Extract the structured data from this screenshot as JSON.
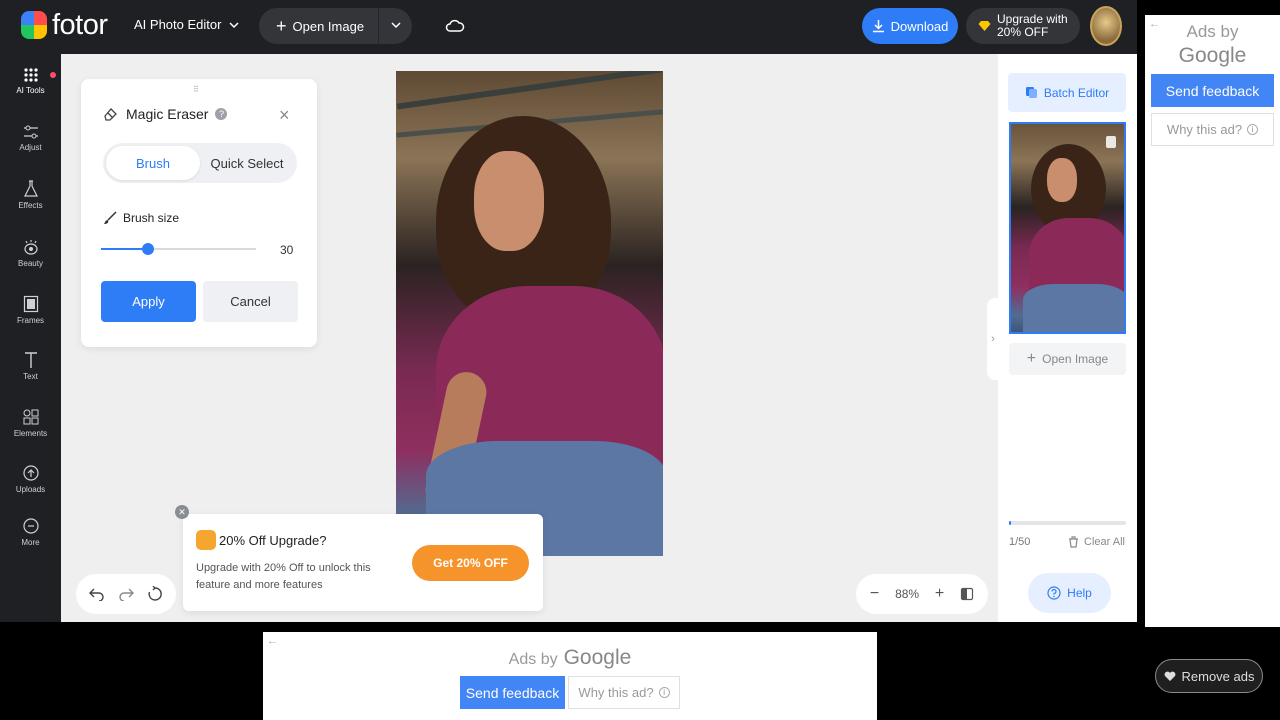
{
  "header": {
    "logo_text": "fotor",
    "app_menu": "AI Photo Editor",
    "open_image": "Open Image",
    "download": "Download",
    "upgrade_line1": "Upgrade with",
    "upgrade_line2": "20% OFF"
  },
  "sidebar": {
    "items": [
      {
        "label": "AI Tools",
        "icon": "grid-icon"
      },
      {
        "label": "Adjust",
        "icon": "sliders-icon"
      },
      {
        "label": "Effects",
        "icon": "flask-icon"
      },
      {
        "label": "Beauty",
        "icon": "eye-icon"
      },
      {
        "label": "Frames",
        "icon": "frame-icon"
      },
      {
        "label": "Text",
        "icon": "text-icon"
      },
      {
        "label": "Elements",
        "icon": "shapes-icon"
      },
      {
        "label": "Uploads",
        "icon": "upload-icon"
      },
      {
        "label": "More",
        "icon": "more-icon"
      }
    ]
  },
  "magic_eraser": {
    "title": "Magic Eraser",
    "tabs": [
      "Brush",
      "Quick Select"
    ],
    "active_tab": "Brush",
    "brush_size_label": "Brush size",
    "brush_size_value": "30",
    "brush_size_fraction": 0.3,
    "apply": "Apply",
    "cancel": "Cancel"
  },
  "promo": {
    "title": "20% Off Upgrade?",
    "text": "Upgrade with 20% Off to unlock this feature and more features",
    "cta": "Get 20% OFF"
  },
  "zoom": {
    "level": "88%",
    "minus": "−",
    "plus": "+"
  },
  "right_panel": {
    "batch_editor": "Batch Editor",
    "open_image": "Open Image",
    "count": "1/50",
    "count_fraction": 0.02,
    "clear_all": "Clear All",
    "help": "Help"
  },
  "ads": {
    "ads_by": "Ads by",
    "google": "Google",
    "send_feedback": "Send feedback",
    "why_this_ad": "Why this ad?",
    "remove_ads": "Remove ads"
  },
  "colors": {
    "accent": "#2e7cf6",
    "topbar": "#1f2024",
    "canvas": "#efeff0",
    "promo_cta": "#f6932a"
  }
}
